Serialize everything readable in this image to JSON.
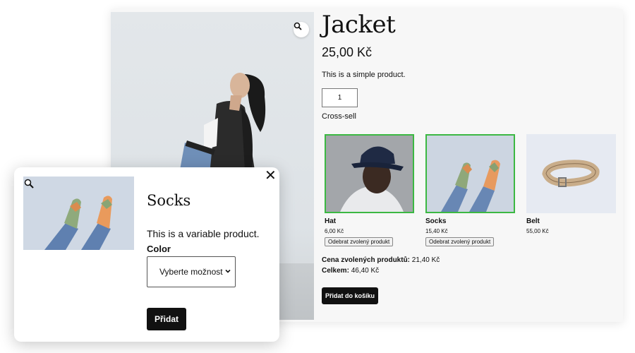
{
  "product": {
    "title": "Jacket",
    "price": "25,00 Kč",
    "description": "This is a simple product.",
    "quantity": "1",
    "cross_sell_label": "Cross-sell",
    "image_icon": "magnifier-icon"
  },
  "cross_sells": [
    {
      "name": "Hat",
      "price": "6,00 Kč",
      "selected": true,
      "remove_label": "Odebrat zvolený produkt"
    },
    {
      "name": "Socks",
      "price": "15,40 Kč",
      "selected": true,
      "remove_label": "Odebrat zvolený produkt"
    },
    {
      "name": "Belt",
      "price": "55,00 Kč",
      "selected": false
    }
  ],
  "totals": {
    "selected_label": "Cena zvolených produktů:",
    "selected_value": "21,40 Kč",
    "total_label": "Celkem:",
    "total_value": "46,40 Kč"
  },
  "add_to_cart_label": "Přidat do košíku",
  "quick_view": {
    "title": "Socks",
    "description": "This is a variable product.",
    "attribute_label": "Color",
    "select_placeholder": "Vyberte možnost",
    "add_label": "Přidat",
    "close_icon": "close-icon"
  },
  "colors": {
    "selected_border": "#3cb843",
    "button_bg": "#111111",
    "card_bg": "#f7f7f7"
  }
}
